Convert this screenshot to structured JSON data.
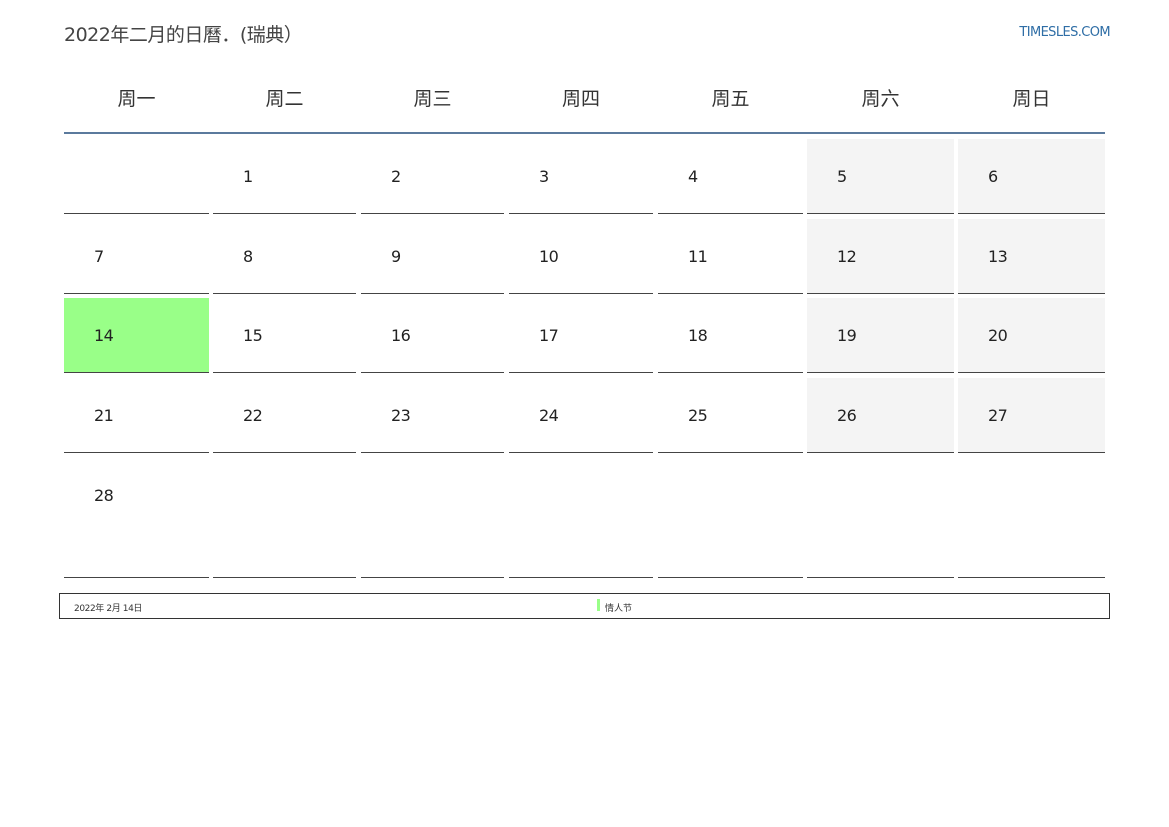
{
  "header": {
    "title": "2022年二月的日曆．(瑞典）",
    "site_link": "TIMESLES.COM"
  },
  "weekdays": [
    "周一",
    "周二",
    "周三",
    "周四",
    "周五",
    "周六",
    "周日"
  ],
  "calendar": {
    "weeks": [
      [
        "",
        "1",
        "2",
        "3",
        "4",
        "5",
        "6"
      ],
      [
        "7",
        "8",
        "9",
        "10",
        "11",
        "12",
        "13"
      ],
      [
        "14",
        "15",
        "16",
        "17",
        "18",
        "19",
        "20"
      ],
      [
        "21",
        "22",
        "23",
        "24",
        "25",
        "26",
        "27"
      ],
      [
        "28",
        "",
        "",
        "",
        "",
        "",
        ""
      ]
    ],
    "highlighted_day": "14"
  },
  "events": [
    {
      "date": "2022年 2月 14日",
      "name": "情人节",
      "color": "#99ff88"
    }
  ],
  "colors": {
    "header_rule": "#5b7a9d",
    "weekend_fill": "#f4f4f4",
    "holiday_fill": "#99ff88",
    "link": "#2f6ea6"
  }
}
